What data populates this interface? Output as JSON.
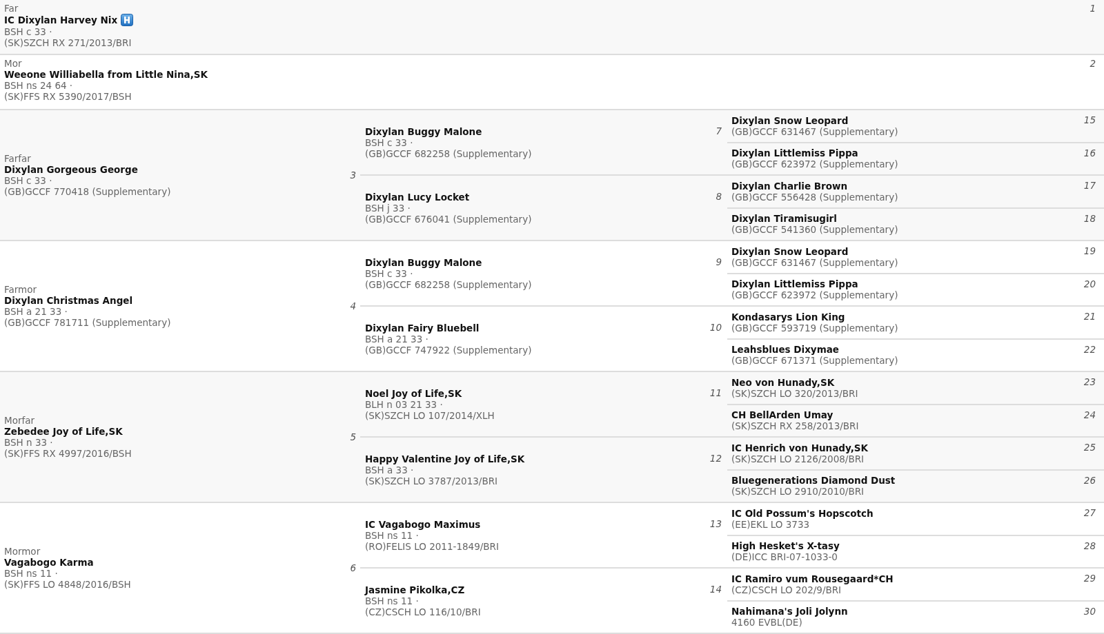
{
  "parents": [
    {
      "label": "Far",
      "name": "IC Dixylan Harvey Nix",
      "marked": true,
      "breed": "BSH c 33 ·",
      "reg": "(SK)SZCH RX 271/2013/BRI",
      "number": "1"
    },
    {
      "label": "Mor",
      "name": "Weeone Williabella from Little Nina,SK",
      "marked": false,
      "breed": "BSH ns 24 64 ·",
      "reg": "(SK)FFS RX 5390/2017/BSH",
      "number": "2"
    }
  ],
  "grandparents": [
    {
      "label": "Farfar",
      "name": "Dixylan Gorgeous George",
      "breed": "BSH c 33 ·",
      "reg": "(GB)GCCF 770418 (Supplementary)",
      "number": "3",
      "ancestors": [
        {
          "name": "Dixylan Buggy Malone",
          "breed": "BSH c 33 ·",
          "reg": "(GB)GCCF 682258 (Supplementary)",
          "number": "7",
          "ancestors": [
            {
              "name": "Dixylan Snow Leopard",
              "reg": "(GB)GCCF 631467 (Supplementary)",
              "number": "15"
            },
            {
              "name": "Dixylan Littlemiss Pippa",
              "reg": "(GB)GCCF 623972 (Supplementary)",
              "number": "16"
            }
          ]
        },
        {
          "name": "Dixylan Lucy Locket",
          "breed": "BSH j 33 ·",
          "reg": "(GB)GCCF 676041 (Supplementary)",
          "number": "8",
          "ancestors": [
            {
              "name": "Dixylan Charlie Brown",
              "reg": "(GB)GCCF 556428 (Supplementary)",
              "number": "17"
            },
            {
              "name": "Dixylan Tiramisugirl",
              "reg": "(GB)GCCF 541360 (Supplementary)",
              "number": "18"
            }
          ]
        }
      ]
    },
    {
      "label": "Farmor",
      "name": "Dixylan Christmas Angel",
      "breed": "BSH a 21 33 ·",
      "reg": "(GB)GCCF 781711 (Supplementary)",
      "number": "4",
      "ancestors": [
        {
          "name": "Dixylan Buggy Malone",
          "breed": "BSH c 33 ·",
          "reg": "(GB)GCCF 682258 (Supplementary)",
          "number": "9",
          "ancestors": [
            {
              "name": "Dixylan Snow Leopard",
              "reg": "(GB)GCCF 631467 (Supplementary)",
              "number": "19"
            },
            {
              "name": "Dixylan Littlemiss Pippa",
              "reg": "(GB)GCCF 623972 (Supplementary)",
              "number": "20"
            }
          ]
        },
        {
          "name": "Dixylan Fairy Bluebell",
          "breed": "BSH a 21 33 ·",
          "reg": "(GB)GCCF 747922 (Supplementary)",
          "number": "10",
          "ancestors": [
            {
              "name": "Kondasarys Lion King",
              "reg": "(GB)GCCF 593719 (Supplementary)",
              "number": "21"
            },
            {
              "name": "Leahsblues Dixymae",
              "reg": "(GB)GCCF 671371 (Supplementary)",
              "number": "22"
            }
          ]
        }
      ]
    },
    {
      "label": "Morfar",
      "name": "Zebedee Joy of Life,SK",
      "breed": "BSH n 33 ·",
      "reg": "(SK)FFS RX 4997/2016/BSH",
      "number": "5",
      "ancestors": [
        {
          "name": "Noel Joy of Life,SK",
          "breed": "BLH n 03 21 33 ·",
          "reg": "(SK)SZCH LO 107/2014/XLH",
          "number": "11",
          "ancestors": [
            {
              "name": "Neo von Hunady,SK",
              "reg": "(SK)SZCH LO 320/2013/BRI",
              "number": "23"
            },
            {
              "name": "CH BellArden Umay",
              "reg": "(SK)SZCH RX 258/2013/BRI",
              "number": "24"
            }
          ]
        },
        {
          "name": "Happy Valentine Joy of Life,SK",
          "breed": "BSH a 33 ·",
          "reg": "(SK)SZCH LO 3787/2013/BRI",
          "number": "12",
          "ancestors": [
            {
              "name": "IC Henrich von Hunady,SK",
              "reg": "(SK)SZCH LO 2126/2008/BRI",
              "number": "25"
            },
            {
              "name": "Bluegenerations Diamond Dust",
              "reg": "(SK)SZCH LO 2910/2010/BRI",
              "number": "26"
            }
          ]
        }
      ]
    },
    {
      "label": "Mormor",
      "name": "Vagabogo Karma",
      "breed": "BSH ns 11 ·",
      "reg": "(SK)FFS LO 4848/2016/BSH",
      "number": "6",
      "ancestors": [
        {
          "name": "IC Vagabogo Maximus",
          "breed": "BSH ns 11 ·",
          "reg": "(RO)FELIS LO 2011-1849/BRI",
          "number": "13",
          "ancestors": [
            {
              "name": "IC Old Possum's Hopscotch",
              "reg": "(EE)EKL LO 3733",
              "number": "27"
            },
            {
              "name": "High Hesket's X-tasy",
              "reg": "(DE)ICC BRI-07-1033-0",
              "number": "28"
            }
          ]
        },
        {
          "name": "Jasmine Pikolka,CZ",
          "breed": "BSH ns 11 ·",
          "reg": "(CZ)CSCH LO 116/10/BRI",
          "number": "14",
          "ancestors": [
            {
              "name": "IC Ramiro vum Rousegaard*CH",
              "reg": "(CZ)CSCH LO 202/9/BRI",
              "number": "29"
            },
            {
              "name": "Nahimana's Joli Jolynn",
              "reg": "4160 EVBL(DE)",
              "number": "30"
            }
          ]
        }
      ]
    }
  ]
}
